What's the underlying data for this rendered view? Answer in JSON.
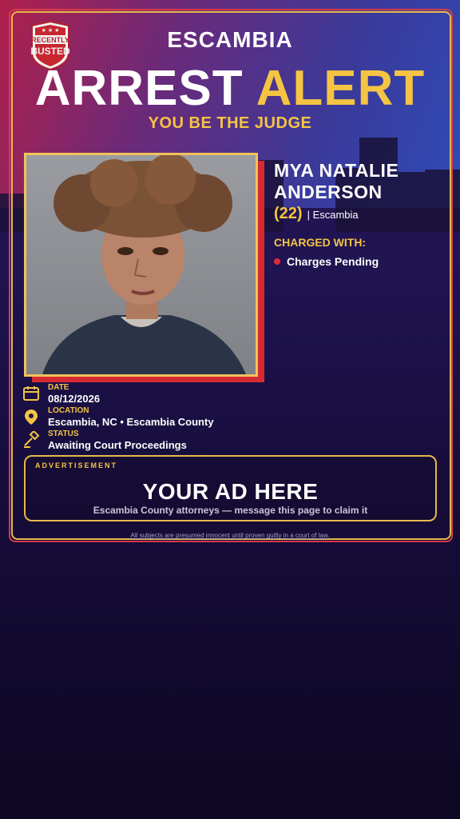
{
  "badge": {
    "line1": "RECENTLY",
    "line2": "BUSTED"
  },
  "header": {
    "county": "ESCAMBIA",
    "headline_word1": "ARREST",
    "headline_word2": "ALERT",
    "tagline": "YOU BE THE JUDGE"
  },
  "subject": {
    "name_line1": "MYA NATALIE",
    "name_line2": "ANDERSON",
    "age": "(22)",
    "county": "| Escambia",
    "charged_label": "CHARGED WITH:",
    "charges": [
      "Charges Pending"
    ]
  },
  "details": {
    "date_label": "DATE",
    "date_value": "08/12/2026",
    "location_label": "LOCATION",
    "location_value": "Escambia, NC • Escambia County",
    "status_label": "STATUS",
    "status_value": "Awaiting Court Proceedings"
  },
  "ad": {
    "label": "ADVERTISEMENT",
    "title": "YOUR AD HERE",
    "subtitle": "Escambia County attorneys — message this page to claim it"
  },
  "disclaimer": "All subjects are presumed innocent until proven guilty in a court of law.",
  "colors": {
    "accent_gold": "#f5c443",
    "accent_red": "#d62a32",
    "frame_gold": "#e6b84a",
    "background_top": "#2a1a5e",
    "background_bottom": "#0d0722"
  },
  "icons": {
    "date": "calendar-icon",
    "location": "map-pin-icon",
    "status": "gavel-icon",
    "charge_bullet": "red-dot-icon"
  }
}
